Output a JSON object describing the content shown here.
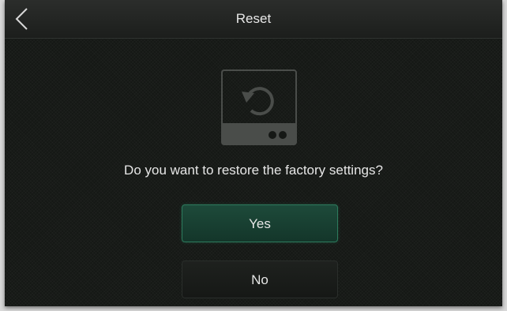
{
  "header": {
    "title": "Reset"
  },
  "dialog": {
    "icon": "factory-reset-device-icon",
    "prompt": "Do you want to restore the factory settings?",
    "yes_label": "Yes",
    "no_label": "No"
  },
  "colors": {
    "accent": "#1d4a3a",
    "accent_border": "#2d7a5d",
    "background": "#151815"
  }
}
